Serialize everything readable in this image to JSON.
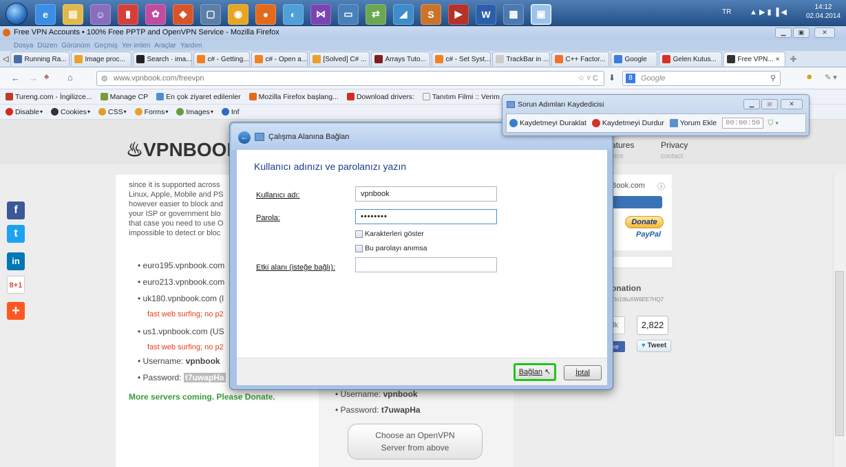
{
  "taskbar": {
    "lang": "TR",
    "time": "14:12",
    "date": "02.04.2014",
    "icons": [
      {
        "name": "ie-icon",
        "glyph": "e",
        "color": "#3a8ee6"
      },
      {
        "name": "explorer-icon",
        "glyph": "▤",
        "color": "#e2b84a"
      },
      {
        "name": "people-icon",
        "glyph": "☺",
        "color": "#8a6dbe"
      },
      {
        "name": "media-icon",
        "glyph": "▮",
        "color": "#d43f3a"
      },
      {
        "name": "paint-icon",
        "glyph": "✿",
        "color": "#c04ba0"
      },
      {
        "name": "tools-icon",
        "glyph": "◆",
        "color": "#d8552a"
      },
      {
        "name": "box-icon",
        "glyph": "▢",
        "color": "#5c7fa8"
      },
      {
        "name": "chrome-icon",
        "glyph": "◉",
        "color": "#e5a624"
      },
      {
        "name": "firefox-icon",
        "glyph": "●",
        "color": "#e46a1b"
      },
      {
        "name": "vpn-icon",
        "glyph": "◐",
        "color": "#4f9fd8"
      },
      {
        "name": "vs-icon",
        "glyph": "⋈",
        "color": "#7a45b0"
      },
      {
        "name": "monitor-icon",
        "glyph": "▭",
        "color": "#4a80b8"
      },
      {
        "name": "network-icon",
        "glyph": "⇄",
        "color": "#6aa84f"
      },
      {
        "name": "app-icon",
        "glyph": "◢",
        "color": "#3f8ccc"
      },
      {
        "name": "slides-icon",
        "glyph": "S",
        "color": "#c9742a"
      },
      {
        "name": "recorder-icon",
        "glyph": "▶",
        "color": "#b4322a"
      },
      {
        "name": "word-icon",
        "glyph": "W",
        "color": "#2b5fad"
      },
      {
        "name": "remote-icon",
        "glyph": "▦",
        "color": "#4c7ab0"
      },
      {
        "name": "steps-icon",
        "glyph": "▣",
        "color": "#6a9ed6"
      }
    ]
  },
  "window": {
    "title": "Free VPN Accounts • 100% Free PPTP and OpenVPN Service - Mozilla Firefox"
  },
  "menu": [
    "Dosya",
    "Düzen",
    "Görünüm",
    "Geçmiş",
    "Yer imleri",
    "Araçlar",
    "Yardım"
  ],
  "tabs": [
    {
      "label": "Running Ra...",
      "color": "#4a6da7"
    },
    {
      "label": "Image proc...",
      "color": "#e8a22b"
    },
    {
      "label": "Search · ima...",
      "color": "#222"
    },
    {
      "label": "c# - Getting...",
      "color": "#f48024"
    },
    {
      "label": "c# - Open a...",
      "color": "#f48024"
    },
    {
      "label": "[Solved] C# ...",
      "color": "#e8a22b"
    },
    {
      "label": "Arrays Tuto...",
      "color": "#7b1f1f"
    },
    {
      "label": "c# - Set Syst...",
      "color": "#f48024"
    },
    {
      "label": "TrackBar in ...",
      "color": "#ccc"
    },
    {
      "label": "C++ Factor...",
      "color": "#f0712c"
    },
    {
      "label": "Google",
      "color": "#3c7be0"
    },
    {
      "label": "Gelen Kutus...",
      "color": "#d93025"
    },
    {
      "label": "Free VPN...",
      "color": "#333"
    }
  ],
  "nav": {
    "url": "www.vpnbook.com/freevpn",
    "search_placeholder": "Google"
  },
  "bookmarks": [
    {
      "label": "Tureng.com - İngilizce...",
      "color": "#c0392b"
    },
    {
      "label": "Manage CP",
      "color": "#7a9b3a"
    },
    {
      "label": "En çok ziyaret edilenler",
      "color": "#4a90d9"
    },
    {
      "label": "Mozilla Firefox başlang...",
      "color": "#e46a1b"
    },
    {
      "label": "Download drivers:",
      "color": "#d42a1f"
    },
    {
      "label": "Tanıtım Filmi :: Verim ...",
      "color": "#eee"
    }
  ],
  "devbar": [
    {
      "label": "Disable",
      "color": "#d42a1f"
    },
    {
      "label": "Cookies",
      "color": "#333"
    },
    {
      "label": "CSS",
      "color": "#e0a020"
    },
    {
      "label": "Forms",
      "color": "#e8a22b"
    },
    {
      "label": "Images",
      "color": "#6a9a3a"
    },
    {
      "label": "Inf",
      "color": "#2b6ac7"
    }
  ],
  "page": {
    "logo": "VPNBOOK",
    "nav_features": "atures",
    "nav_service": "vice",
    "nav_privacy": "Privacy",
    "nav_contact": "contact",
    "intro": [
      "since it is supported across",
      "Linux, Apple, Mobile and PS",
      "however easier to block and",
      "your ISP or government blo",
      "that case you need to use O",
      "impossible to detect or bloc"
    ],
    "servers": [
      {
        "host": "euro195.vpnbook.com",
        "note": ""
      },
      {
        "host": "euro213.vpnbook.com",
        "note": ""
      },
      {
        "host": "uk180.vpnbook.com (l",
        "note": "fast web surfing; no p2"
      },
      {
        "host": "us1.vpnbook.com (US",
        "note": "fast web surfing; no p2"
      }
    ],
    "username_label": "Username:",
    "username": "vpnbook",
    "password_label": "Password:",
    "password": "t7uwapHa",
    "more": "More servers coming. Please Donate.",
    "donate_email": "Book.com",
    "donate_btn": "Donate",
    "paypal": "PayPal",
    "donation_head": "onation",
    "btc": "Ttn1t8uXW6EE7HQ7",
    "likes_frag": "lk",
    "tweet_count": "2,822",
    "like_frag": "ke",
    "tweet": "Tweet",
    "ovpn_username_label": "Username:",
    "ovpn_username": "vpnbook",
    "ovpn_password_label": "Password:",
    "ovpn_password": "t7uwapHa",
    "choose": [
      "Choose an OpenVPN",
      "Server from above"
    ]
  },
  "dialog": {
    "title": "Çalışma Alanına Bağlan",
    "heading": "Kullanıcı adınızı ve parolanızı yazın",
    "username_label": "Kullanıcı adı:",
    "username": "vpnbook",
    "password_label": "Parola:",
    "password": "••••••••",
    "show_chars": "Karakterleri göster",
    "remember": "Bu parolayı anımsa",
    "domain_label": "Etki alanı (isteğe bağlı):",
    "domain": "",
    "connect": "Bağlan",
    "cancel": "İptal"
  },
  "recorder": {
    "title": "Sorun Adımları Kaydedicisi",
    "pause": "Kaydetmeyi Duraklat",
    "stop": "Kaydetmeyi Durdur",
    "comment": "Yorum Ekle",
    "timer": "00:00:50"
  }
}
